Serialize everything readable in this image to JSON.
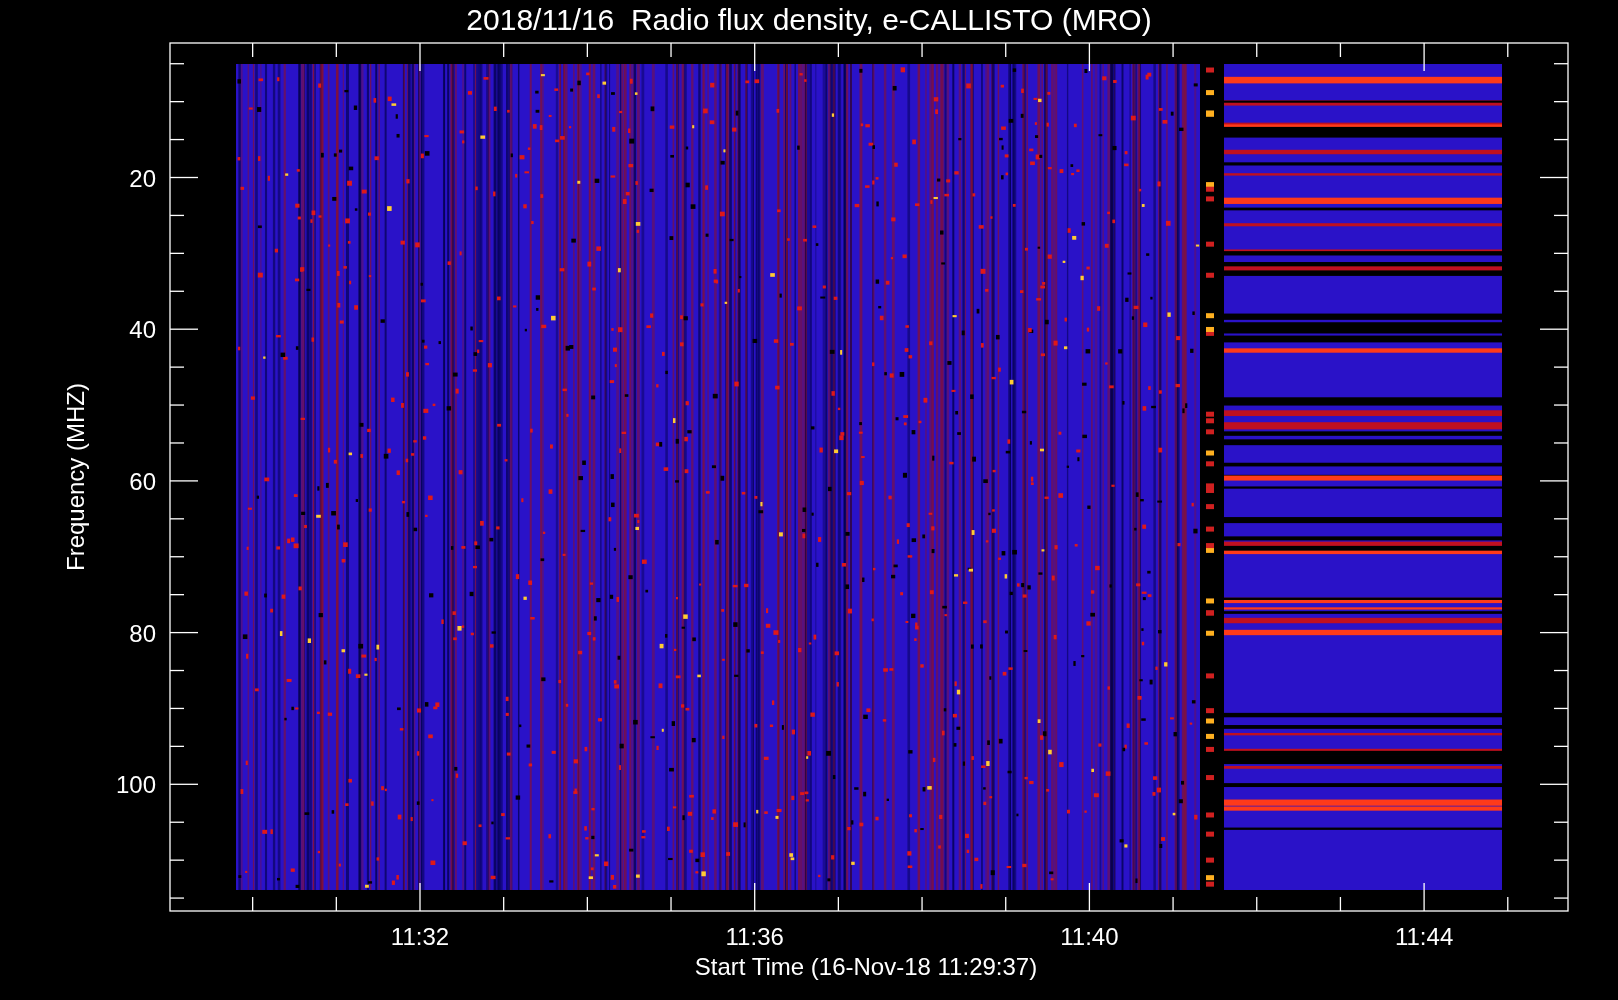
{
  "plot": {
    "title": "2018/11/16  Radio flux density, e-CALLISTO (MRO)",
    "ylabel": "Frequency (MHZ)",
    "xlabel": "Start Time (16-Nov-18 11:29:37)",
    "yticks": [
      "20",
      "40",
      "60",
      "80",
      "100"
    ],
    "xticks": [
      "11:32",
      "11:36",
      "11:40",
      "11:44"
    ]
  }
}
